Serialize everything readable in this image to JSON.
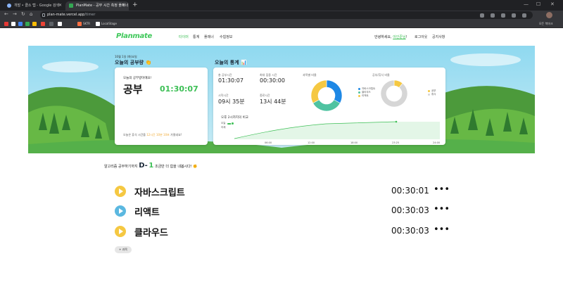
{
  "browser": {
    "tabs": [
      {
        "title": "개발 • 클소 탭 - Google 검색",
        "active": false
      },
      {
        "title": "PlanMate - 공부 시간 측정 플래너",
        "active": true
      }
    ],
    "url_host": "plan-mate.vercel.app",
    "url_path": "/timer",
    "bookmarks": [
      "SKTR",
      "LocalStage"
    ],
    "all_bookmarks_label": "모든 북마크"
  },
  "header": {
    "logo": "Planmate",
    "nav": [
      "타이머",
      "통계",
      "플래너",
      "수험정보"
    ],
    "active_nav": "타이머",
    "greeting_prefix": "안녕하세요, ",
    "nickname": "아인준님",
    "greeting_suffix": "!",
    "logout": "로그아웃",
    "notice": "공지사항"
  },
  "today": {
    "date": "10월 1일 (화)요일",
    "title": "오늘의 공부량",
    "title_emoji": "👏",
    "card_label": "오늘의 공부량이에요!",
    "subject": "공부",
    "time": "01:30:07",
    "rest_prefix": "오늘은 휴식 시간을 ",
    "rest_highlight": "12시간 10분 10초",
    "rest_suffix": " 가졌네요!"
  },
  "stats": {
    "title": "오늘의 통계",
    "title_emoji": "📊",
    "total_label": "총 공부시간",
    "total_value": "01:30:07",
    "max_label": "최대 집중 시간",
    "max_value": "00:30:00",
    "start_label": "시작시간",
    "start_value": "09시 35분",
    "end_label": "종료시간",
    "end_value": "13시 44분",
    "subject_ratio_label": "과목별 비율",
    "study_rest_label": "공부/휴식 비율",
    "subject_legend": [
      "자바스크립트",
      "클라우드",
      "리액트"
    ],
    "study_rest_legend": [
      "공부",
      "휴식"
    ],
    "compare_title": "오후 2시까지의 비교",
    "compare_rows": [
      "오늘",
      "어제"
    ],
    "colors": {
      "green": "#3cbf55",
      "blue": "#1e88e5",
      "teal": "#4fc3a1",
      "yellow": "#f5c842",
      "gray": "#d6d6d6"
    }
  },
  "chart_data": [
    {
      "type": "pie",
      "title": "과목별 비율",
      "categories": [
        "자바스크립트",
        "클라우드",
        "리액트"
      ],
      "values": [
        33,
        34,
        33
      ]
    },
    {
      "type": "pie",
      "title": "공부/휴식 비율",
      "categories": [
        "공부",
        "휴식"
      ],
      "values": [
        11,
        89
      ]
    },
    {
      "type": "area",
      "title": "오후 2시까지의 비교",
      "x": [
        "06:00",
        "12:00",
        "18:00",
        "23:25",
        "24:00"
      ],
      "xlabel": "",
      "ylabel": ""
    }
  ],
  "dday": {
    "prefix": "알고리즘 공부하기까지 ",
    "big": "D-",
    "num": "1",
    "suffix": " 조금만 더 힘을 내봅시다!",
    "emoji": "✊"
  },
  "subjects": [
    {
      "name": "자바스크립트",
      "time": "00:30:01",
      "color": "#f5c842"
    },
    {
      "name": "리액트",
      "time": "00:30:03",
      "color": "#5bb8e0"
    },
    {
      "name": "클라우드",
      "time": "00:30:03",
      "color": "#f5c842"
    }
  ],
  "more_label": "•••",
  "add_subject": "+ 과목"
}
